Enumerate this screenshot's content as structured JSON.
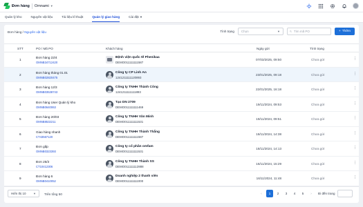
{
  "app": {
    "name": "Đơn hàng",
    "brand": "Omnami"
  },
  "nav": {
    "tabs": [
      {
        "label": "Quản lý kho",
        "active": false
      },
      {
        "label": "Nguyên vật liệu",
        "active": false
      },
      {
        "label": "Tài liệu kĩ thuật",
        "active": false
      },
      {
        "label": "Quản lý giao hàng",
        "active": true
      },
      {
        "label": "Cài đặt",
        "active": false
      }
    ]
  },
  "breadcrumb": {
    "root": "Đơn hàng",
    "separator": " / ",
    "current": "Nguyên vật liệu"
  },
  "filters": {
    "status_label": "Tình trạng",
    "status_placeholder": "Chọn",
    "search_placeholder": "Tìm mã PO",
    "add_button": "Thêm"
  },
  "table": {
    "headers": {
      "stt": "STT",
      "po": "PO / Mã PO",
      "customer": "Khách hàng",
      "date": "Ngày gửi",
      "status": "Tình trạng"
    },
    "rows": [
      {
        "stt": "1",
        "po_name": "Đơn hàng 22/4",
        "po_code": "OMNB34712420",
        "customer": "Bệnh viện quốc tế Phenikaa",
        "customer_code": "DEMO011111111587",
        "date": "07/03/2025, 09:50",
        "status": "Chưa gửi",
        "avatar": "logo"
      },
      {
        "stt": "2",
        "po_name": "Đơn hàng tháng 01.01",
        "po_code": "OMNB02820475",
        "customer": "Công ty CP Linh An",
        "customer_code": "1241211111120893",
        "date": "23/01/2025, 09:18",
        "status": "Chưa gửi",
        "avatar": "person"
      },
      {
        "stt": "3",
        "po_name": "Đơn hàng 12/3",
        "po_code": "OMNB03538743",
        "customer": "Công ty TNHH Thành Công",
        "customer_code": "1241211111111893",
        "date": "22/01/2025, 16:18",
        "status": "Chưa gửi",
        "avatar": "person"
      },
      {
        "stt": "4",
        "po_name": "Đơn hàng User Quản lý kho",
        "po_code": "OMNB0640063",
        "customer": "Tạo DN 2709",
        "customer_code": "DEMO011111111469",
        "date": "19/11/2024, 09:53",
        "status": "Chưa gửi",
        "avatar": "person"
      },
      {
        "stt": "5",
        "po_name": "Đơn hàng 20/03",
        "po_code": "OMNB8532211",
        "customer": "Công ty TNHH Văn Minh",
        "customer_code": "DEMO011111111531",
        "date": "19/11/2024, 09:51",
        "status": "Chưa gửi",
        "avatar": "person"
      },
      {
        "stt": "6",
        "po_name": "Giao hàng nhanh",
        "po_code": "CT43567120",
        "customer": "Công ty TNHH Thành Thắng",
        "customer_code": "DEMO011111111587",
        "date": "18/11/2024, 14:38",
        "status": "Chưa gửi",
        "avatar": "person"
      },
      {
        "stt": "7",
        "po_name": "Đơn gấp",
        "po_code": "OMNB0323393",
        "customer": "Công ty cổ phần omfam",
        "customer_code": "DEMO011111111531",
        "date": "18/11/2024, 14:13",
        "status": "Chưa gửi",
        "avatar": "person"
      },
      {
        "stt": "8",
        "po_name": "Đơn 25/3",
        "po_code": "CT10412306",
        "customer": "Công ty TNHH Thành SS",
        "customer_code": "DEMO011111112888",
        "date": "16/11/2024, 15:29",
        "status": "Chưa gửi",
        "avatar": "person"
      },
      {
        "stt": "9",
        "po_name": "Đơn hàng 6",
        "po_code": "OMNB0410052",
        "customer": "Doanh nghiệp 2 thanh viên",
        "customer_code": "DEMO011111111000",
        "date": "16/11/2024, 11:48",
        "status": "Chưa gửi",
        "avatar": "person"
      }
    ]
  },
  "footer": {
    "page_size": "Hiển thị 10",
    "total_label": "Trên tổng",
    "total_value": "50",
    "pages": [
      "1",
      "2",
      "3",
      "4",
      "5"
    ],
    "active_page": "1",
    "prev": "‹",
    "next": "›",
    "goto_label": "Đi đến trang"
  },
  "colors": {
    "accent": "#1d6fd8",
    "link": "#1d4ed8",
    "highlight_row": "#eef5fc",
    "background": "#eef0f4"
  }
}
